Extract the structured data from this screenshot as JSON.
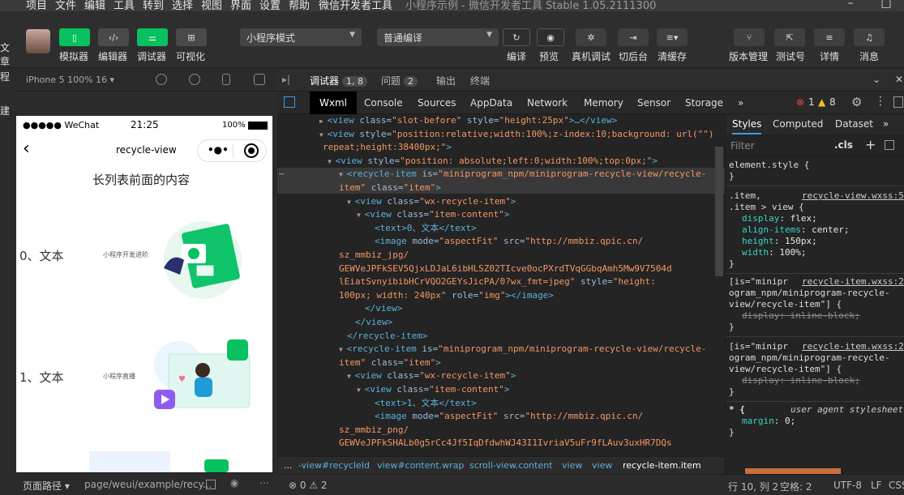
{
  "menubar": {
    "items": [
      "项目",
      "文件",
      "编辑",
      "工具",
      "转到",
      "选择",
      "视图",
      "界面",
      "设置",
      "帮助",
      "微信开发者工具"
    ],
    "title": "小程序示例 - 微信开发者工具 Stable 1.05.2111300"
  },
  "toolbar": {
    "left_buttons": [
      "模拟器",
      "编辑器",
      "调试器",
      "可视化"
    ],
    "mode_select": "小程序模式",
    "compile_select": "普通编译",
    "actions": [
      "编译",
      "预览",
      "真机调试",
      "切后台",
      "清缓存"
    ],
    "right_actions": [
      "版本管理",
      "测试号",
      "详情",
      "消息"
    ]
  },
  "left_edge": [
    "文章",
    "程",
    "建标"
  ],
  "simulator": {
    "device": "iPhone 5 100% 16 ▾",
    "status_carrier": "●●●●● WeChat",
    "status_time": "21:25",
    "status_battery": "100%",
    "nav_title": "recycle-view",
    "header_text": "长列表前面的内容",
    "items": [
      {
        "text": "0、文本",
        "caption": "小程序开发进阶"
      },
      {
        "text": "1、文本",
        "caption": "小程序直播"
      }
    ]
  },
  "page_path": {
    "label": "页面路径 ▾",
    "path": "page/weui/example/recy..."
  },
  "debugger": {
    "tabs": [
      {
        "label": "调试器",
        "badge": "1, 8"
      },
      {
        "label": "问题",
        "badge": "2"
      },
      {
        "label": "输出",
        "badge": ""
      },
      {
        "label": "终端",
        "badge": ""
      }
    ],
    "devtools_tabs": [
      "Wxml",
      "Console",
      "Sources",
      "AppData",
      "Network",
      "Memory",
      "Sensor",
      "Storage",
      "»"
    ],
    "errors": "1",
    "warnings": "8"
  },
  "dom_lines": [
    {
      "tag": "<view ",
      "attr": "class=",
      "val": "\"slot-before\"",
      "attr2": " style=",
      "val2": "\"height:25px\"",
      "rest": ">…</view>"
    },
    {
      "tag": "<view ",
      "attr": "style=",
      "val": "\"position:relative;width:100%;z-index:10;background: url(\"\")",
      "attr2": "",
      "val2": "",
      "rest": ""
    },
    {
      "tag": "",
      "attr": "",
      "val": "repeat;height:38400px;\"",
      "attr2": "",
      "val2": "",
      "rest": ">"
    },
    {
      "tag": "<view ",
      "attr": "style=",
      "val": "\"position: absolute;left:0;width:100%;top:0px;\"",
      "attr2": "",
      "val2": "",
      "rest": ">"
    },
    {
      "tag": "<recycle-item ",
      "attr": "is=",
      "val": "\"miniprogram_npm/miniprogram-recycle-view/recycle-",
      "attr2": "",
      "val2": "",
      "rest": ""
    },
    {
      "tag": "",
      "attr": "",
      "val": "item\"",
      "attr2": " class=",
      "val2": "\"item\"",
      "rest": ">"
    },
    {
      "tag": "<view ",
      "attr": "class=",
      "val": "\"wx-recycle-item\"",
      "attr2": "",
      "val2": "",
      "rest": ">"
    },
    {
      "tag": "<view ",
      "attr": "class=",
      "val": "\"item-content\"",
      "attr2": "",
      "val2": "",
      "rest": ">"
    },
    {
      "tag": "<text>",
      "attr": "",
      "val": "",
      "attr2": "",
      "val2": "",
      "rest": "0、文本</text>"
    },
    {
      "tag": "<image ",
      "attr": "mode=",
      "val": "\"aspectFit\"",
      "attr2": " src=",
      "val2": "\"http://mmbiz.qpic.cn/",
      "rest": ""
    },
    {
      "tag": "",
      "attr": "",
      "val": "sz_mmbiz_jpg/",
      "attr2": "",
      "val2": "",
      "rest": ""
    },
    {
      "tag": "",
      "attr": "",
      "val": "GEWVeJPFkSEV5QjxLDJaL6ibHLSZ02TIcve0ocPXrdTVqGGbqAmh5Mw9V7504d",
      "attr2": "",
      "val2": "",
      "rest": ""
    },
    {
      "tag": "",
      "attr": "",
      "val": "lEiatSvnyibibHCrVQO2GEYsJicPA/0?wx_fmt=jpeg\"",
      "attr2": " style=",
      "val2": "\"height:",
      "rest": ""
    },
    {
      "tag": "",
      "attr": "",
      "val": "100px; width: 240px\"",
      "attr2": " role=",
      "val2": "\"img\"",
      "rest": "></image>"
    },
    {
      "tag": "</view>",
      "attr": "",
      "val": "",
      "attr2": "",
      "val2": "",
      "rest": ""
    },
    {
      "tag": "</view>",
      "attr": "",
      "val": "",
      "attr2": "",
      "val2": "",
      "rest": ""
    },
    {
      "tag": "</recycle-item>",
      "attr": "",
      "val": "",
      "attr2": "",
      "val2": "",
      "rest": ""
    },
    {
      "tag": "<recycle-item ",
      "attr": "is=",
      "val": "\"miniprogram_npm/miniprogram-recycle-view/recycle-",
      "attr2": "",
      "val2": "",
      "rest": ""
    },
    {
      "tag": "",
      "attr": "",
      "val": "item\"",
      "attr2": " class=",
      "val2": "\"item\"",
      "rest": ">"
    },
    {
      "tag": "<view ",
      "attr": "class=",
      "val": "\"wx-recycle-item\"",
      "attr2": "",
      "val2": "",
      "rest": ">"
    },
    {
      "tag": "<view ",
      "attr": "class=",
      "val": "\"item-content\"",
      "attr2": "",
      "val2": "",
      "rest": ">"
    },
    {
      "tag": "<text>",
      "attr": "",
      "val": "",
      "attr2": "",
      "val2": "",
      "rest": "1、文本</text>"
    },
    {
      "tag": "<image ",
      "attr": "mode=",
      "val": "\"aspectFit\"",
      "attr2": " src=",
      "val2": "\"http://mmbiz.qpic.cn/",
      "rest": ""
    },
    {
      "tag": "",
      "attr": "",
      "val": "sz_mmbiz_png/",
      "attr2": "",
      "val2": "",
      "rest": ""
    },
    {
      "tag": "",
      "attr": "",
      "val": "GEWVeJPFkSHALb0g5rCc4Jf5IqDfdwhWJ43I1IvriaV5uFr9fLAuv3uxHR7DQs",
      "attr2": "",
      "val2": "",
      "rest": ""
    }
  ],
  "breadcrumbs": [
    "...",
    "-view#recycleId",
    "view#content.wrap",
    "scroll-view.content",
    "view",
    "view",
    "recycle-item.item"
  ],
  "styles": {
    "tabs": [
      "Styles",
      "Computed",
      "Dataset",
      "»"
    ],
    "filter_placeholder": "Filter",
    "cls": ".cls",
    "element_style": "element.style {",
    "rule1_selector": ".item,",
    "rule1_selector2": ".item > view {",
    "rule1_source": "recycle-view.wxss:5",
    "rule1_props": [
      {
        "name": "display",
        "value": "flex;"
      },
      {
        "name": "align-items",
        "value": "center;"
      },
      {
        "name": "height",
        "value": "150px;"
      },
      {
        "name": "width",
        "value": "100%;"
      }
    ],
    "rule2_selector": "[is=\"minipr",
    "rule2_selector2": "ogram_npm/miniprogram-recycle-",
    "rule2_selector3": "view/recycle-item\"] {",
    "rule2_source": "recycle-item.wxss:2",
    "rule2_prop": "display: inline-block;",
    "ua_label": "user agent stylesheet",
    "ua_selector": "* {",
    "ua_prop_name": "margin",
    "ua_prop_value": "0;",
    "close": "}"
  },
  "footer": {
    "issues": "⊗ 0 ⚠ 2",
    "position": "行 10, 列 2",
    "spaces": "空格: 2",
    "encoding": "UTF-8",
    "eol": "LF",
    "lang": "CSS"
  }
}
